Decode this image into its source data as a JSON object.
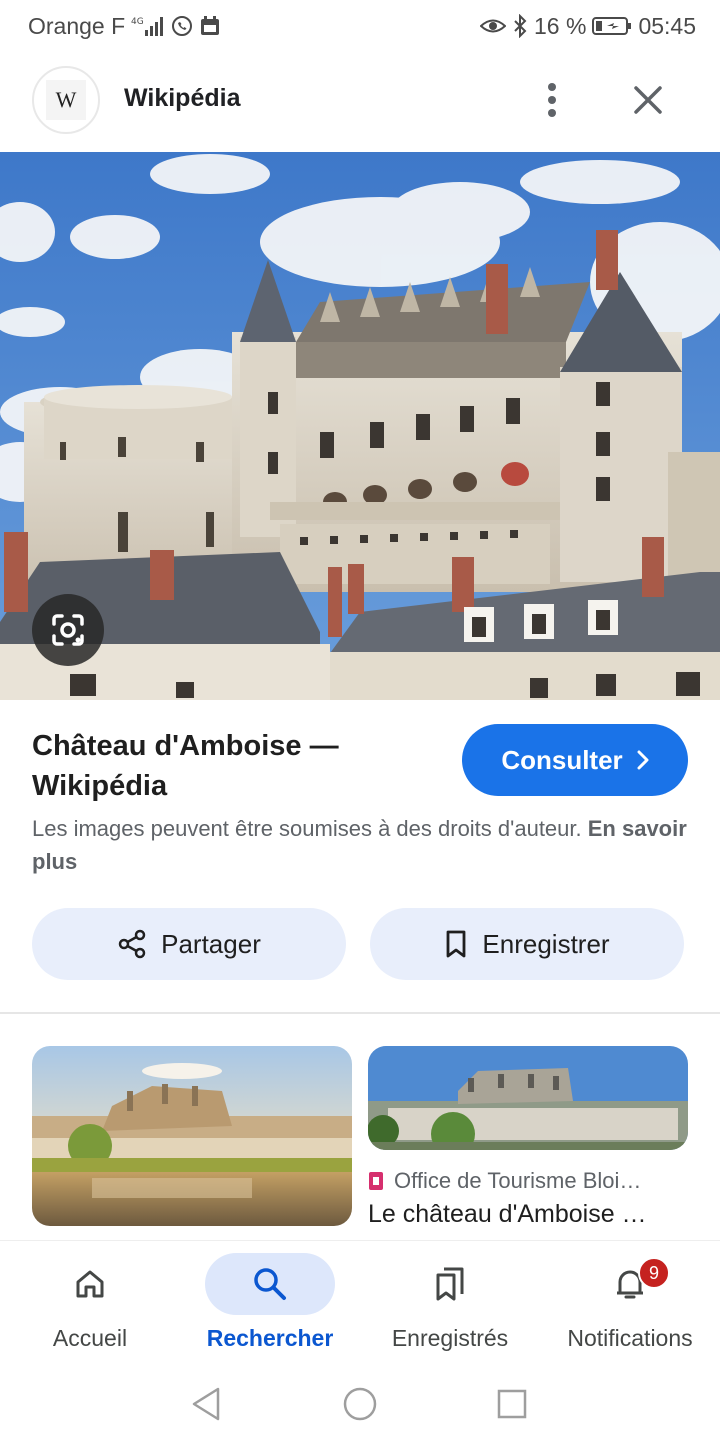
{
  "status_bar": {
    "carrier": "Orange F",
    "battery": "16 %",
    "time": "05:45"
  },
  "header": {
    "logo_letter": "W",
    "site_name": "Wikipédia"
  },
  "result": {
    "title": "Château d'Amboise — Wikipédia",
    "visit_label": "Consulter",
    "copyright_text": "Les images peuvent être soumises à des droits d'auteur.",
    "learn_more": "En savoir plus"
  },
  "actions": {
    "share_label": "Partager",
    "save_label": "Enregistrer"
  },
  "related": [
    {
      "source": "",
      "title": ""
    },
    {
      "source": "Office de Tourisme Bloi…",
      "title": "Le château d'Amboise …"
    }
  ],
  "bottom_nav": [
    {
      "label": "Accueil",
      "icon": "home-icon",
      "active": false
    },
    {
      "label": "Rechercher",
      "icon": "search-icon",
      "active": true
    },
    {
      "label": "Enregistrés",
      "icon": "bookmarks-icon",
      "active": false
    },
    {
      "label": "Notifications",
      "icon": "bell-icon",
      "active": false,
      "badge": "9"
    }
  ],
  "colors": {
    "accent": "#1a73e8",
    "nav_active": "#0b57d0",
    "action_bg": "#e8eefb",
    "badge": "#c5221f"
  }
}
